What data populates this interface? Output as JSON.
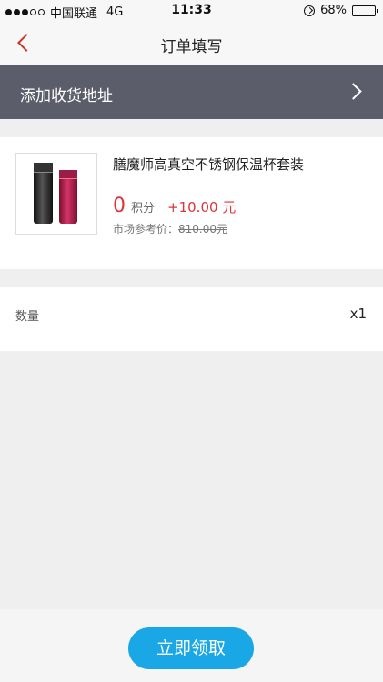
{
  "status_bar": {
    "carrier": "中国联通",
    "network": "4G",
    "time": "11:33",
    "battery": "68%",
    "battery_level": 0.68
  },
  "nav": {
    "title": "订单填写"
  },
  "address": {
    "label": "添加收货地址"
  },
  "product": {
    "name": "膳魔师高真空不锈钢保温杯套装",
    "points_value": "0",
    "points_unit": "积分",
    "cash_price": "+10.00 元",
    "market_label": "市场参考价：",
    "market_price": "810.00元"
  },
  "quantity": {
    "label": "数量",
    "value": "x1"
  },
  "footer": {
    "button_label": "立即领取"
  },
  "colors": {
    "accent_red": "#e0323a",
    "button_blue": "#1aa7e6",
    "address_bar_bg": "#5c5d6a"
  }
}
